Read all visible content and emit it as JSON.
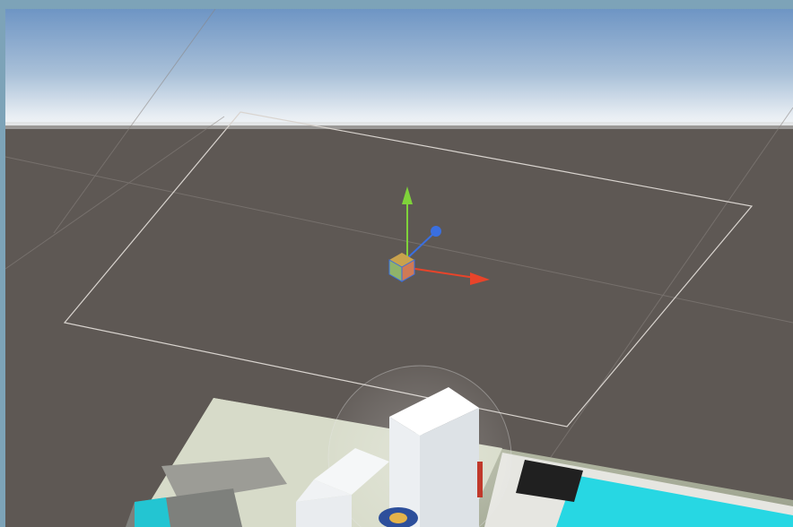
{
  "scene_view": {
    "skybox_colors": {
      "top": "#6e95c4",
      "horizon": "#e7edf3",
      "ground": "#5e5854"
    },
    "frame_color": "#7da3b8",
    "gizmo": {
      "x_axis_color": "#e8442a",
      "y_axis_color": "#7fd23a",
      "z_axis_color": "#3a6fe0",
      "center_cube_color": "#c9a24d"
    },
    "plane_outline_color": "#d9d4cf",
    "objects": [
      "ground-plane",
      "floor-tile",
      "white-box-tall",
      "white-box-small",
      "textured-floor-image"
    ]
  }
}
